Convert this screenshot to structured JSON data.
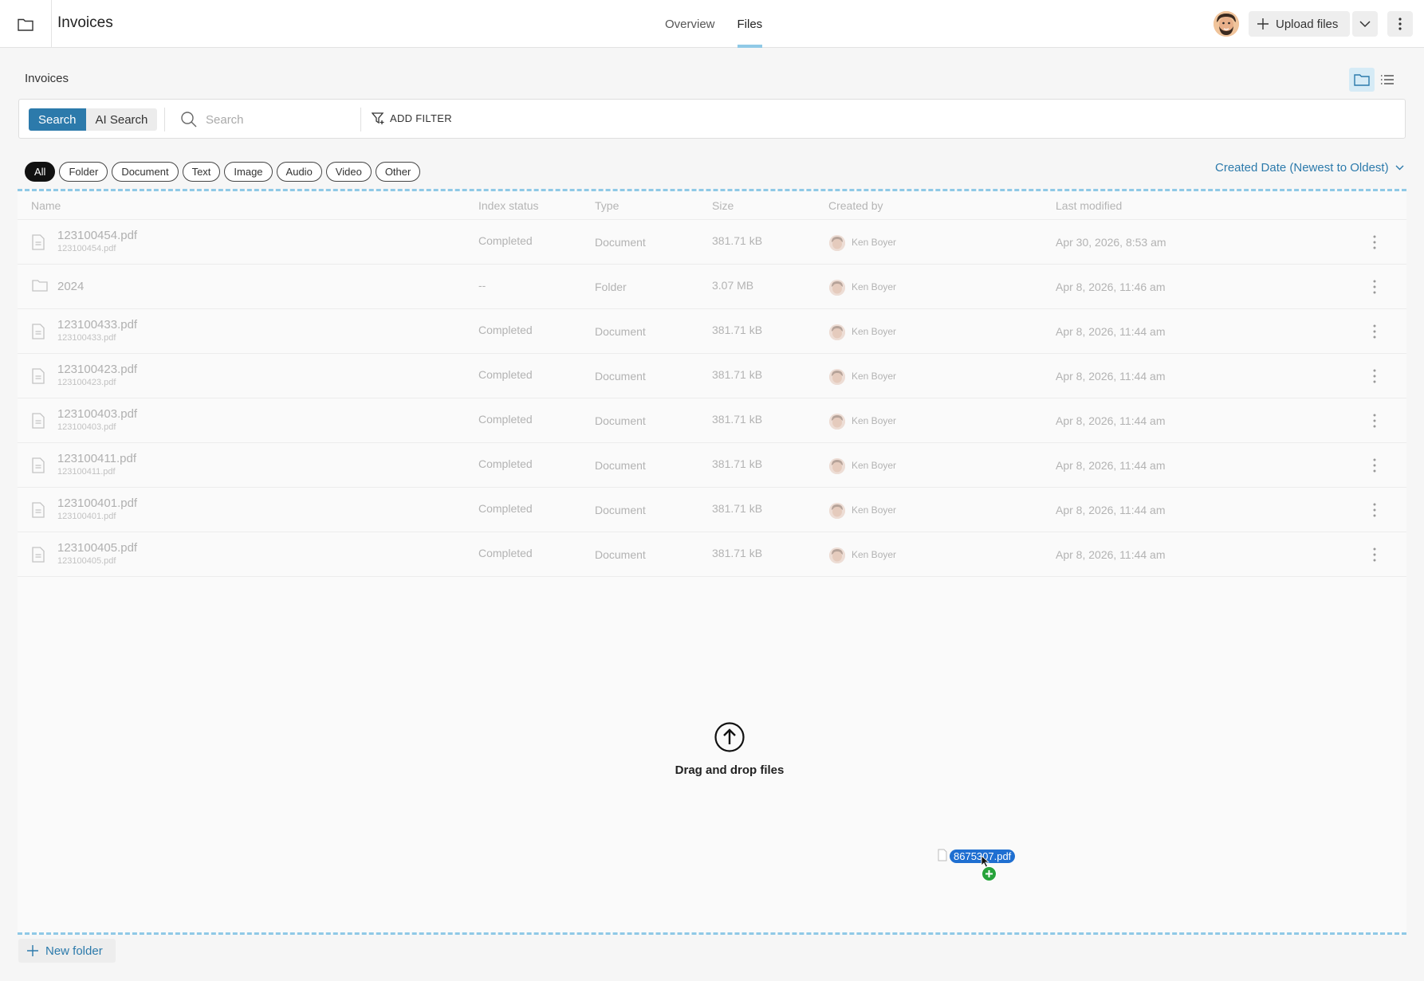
{
  "header": {
    "title": "Invoices",
    "tabs": [
      {
        "label": "Overview"
      },
      {
        "label": "Files"
      }
    ],
    "upload_label": "Upload files"
  },
  "breadcrumb": "Invoices",
  "search": {
    "modes": [
      "Search",
      "AI Search"
    ],
    "placeholder": "Search",
    "value": "",
    "add_filter": "ADD FILTER"
  },
  "filters": [
    "All",
    "Folder",
    "Document",
    "Text",
    "Image",
    "Audio",
    "Video",
    "Other"
  ],
  "sort_label": "Created Date (Newest to Oldest)",
  "table": {
    "columns": [
      "Name",
      "Index status",
      "Type",
      "Size",
      "Created by",
      "Last modified"
    ],
    "rows": [
      {
        "name": "123100454.pdf",
        "sub": "123100454.pdf",
        "icon": "document-icon",
        "status": "Completed",
        "type": "Document",
        "size": "381.71 kB",
        "creator": "Ken Boyer",
        "modified": "Apr 30, 2026, 8:53 am"
      },
      {
        "name": "2024",
        "sub": "",
        "icon": "folder-icon",
        "status": "--",
        "type": "Folder",
        "size": "3.07 MB",
        "creator": "Ken Boyer",
        "modified": "Apr 8, 2026, 11:46 am"
      },
      {
        "name": "123100433.pdf",
        "sub": "123100433.pdf",
        "icon": "document-icon",
        "status": "Completed",
        "type": "Document",
        "size": "381.71 kB",
        "creator": "Ken Boyer",
        "modified": "Apr 8, 2026, 11:44 am"
      },
      {
        "name": "123100423.pdf",
        "sub": "123100423.pdf",
        "icon": "document-icon",
        "status": "Completed",
        "type": "Document",
        "size": "381.71 kB",
        "creator": "Ken Boyer",
        "modified": "Apr 8, 2026, 11:44 am"
      },
      {
        "name": "123100403.pdf",
        "sub": "123100403.pdf",
        "icon": "document-icon",
        "status": "Completed",
        "type": "Document",
        "size": "381.71 kB",
        "creator": "Ken Boyer",
        "modified": "Apr 8, 2026, 11:44 am"
      },
      {
        "name": "123100411.pdf",
        "sub": "123100411.pdf",
        "icon": "document-icon",
        "status": "Completed",
        "type": "Document",
        "size": "381.71 kB",
        "creator": "Ken Boyer",
        "modified": "Apr 8, 2026, 11:44 am"
      },
      {
        "name": "123100401.pdf",
        "sub": "123100401.pdf",
        "icon": "document-icon",
        "status": "Completed",
        "type": "Document",
        "size": "381.71 kB",
        "creator": "Ken Boyer",
        "modified": "Apr 8, 2026, 11:44 am"
      },
      {
        "name": "123100405.pdf",
        "sub": "123100405.pdf",
        "icon": "document-icon",
        "status": "Completed",
        "type": "Document",
        "size": "381.71 kB",
        "creator": "Ken Boyer",
        "modified": "Apr 8, 2026, 11:44 am"
      }
    ]
  },
  "dropzone": {
    "text": "Drag and drop files"
  },
  "dragging_file": "8675307.pdf",
  "new_folder_label": "New folder",
  "colors": {
    "accent": "#2c7aab",
    "dropzone_border": "#8fc9e6",
    "drag_label": "#1f6fd1",
    "drag_plus": "#27a33b"
  }
}
